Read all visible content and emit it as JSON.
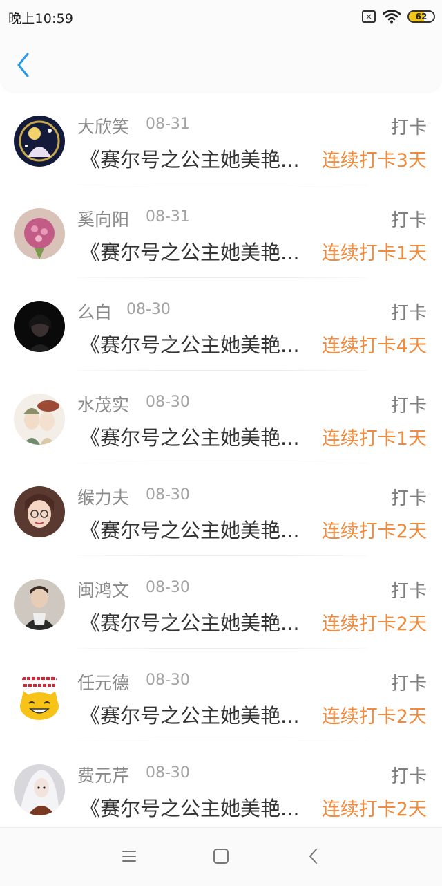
{
  "status_bar": {
    "time": "晚上10:59",
    "battery_level": "62",
    "battery_fraction": 0.62,
    "icons": [
      "sim-off-icon",
      "wifi-icon",
      "battery-icon"
    ],
    "sim_glyph": "×"
  },
  "header": {
    "back_icon": "chevron-left-icon",
    "accent_color": "#2b9be8"
  },
  "colors": {
    "streak": "#f08a3c",
    "username": "#8a8a8a",
    "title": "#333333"
  },
  "items": [
    {
      "username": "大欣笑",
      "date": "08-31",
      "action": "打卡",
      "book": "《赛尔号之公主她美艳...",
      "streak": "连续打卡3天"
    },
    {
      "username": "奚向阳",
      "date": "08-31",
      "action": "打卡",
      "book": "《赛尔号之公主她美艳...",
      "streak": "连续打卡1天"
    },
    {
      "username": "么白",
      "date": "08-30",
      "action": "打卡",
      "book": "《赛尔号之公主她美艳...",
      "streak": "连续打卡4天"
    },
    {
      "username": "水茂实",
      "date": "08-30",
      "action": "打卡",
      "book": "《赛尔号之公主她美艳...",
      "streak": "连续打卡1天"
    },
    {
      "username": "缑力夫",
      "date": "08-30",
      "action": "打卡",
      "book": "《赛尔号之公主她美艳...",
      "streak": "连续打卡2天"
    },
    {
      "username": "闽鸿文",
      "date": "08-30",
      "action": "打卡",
      "book": "《赛尔号之公主她美艳...",
      "streak": "连续打卡2天"
    },
    {
      "username": "任元德",
      "date": "08-30",
      "action": "打卡",
      "book": "《赛尔号之公主她美艳...",
      "streak": "连续打卡2天"
    },
    {
      "username": "费元芹",
      "date": "08-30",
      "action": "打卡",
      "book": "《赛尔号之公主她美艳...",
      "streak": "连续打卡2天"
    }
  ],
  "nav_bar": {
    "icons": [
      "menu-icon",
      "home-icon",
      "back-icon"
    ]
  }
}
